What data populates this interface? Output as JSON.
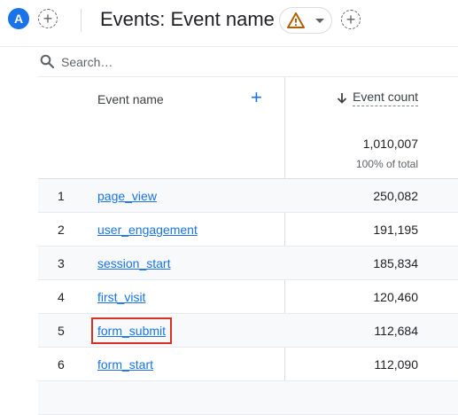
{
  "header": {
    "avatar_letter": "A",
    "title": "Events: Event name"
  },
  "search": {
    "placeholder": "Search…"
  },
  "table": {
    "col_name_header": "Event name",
    "col_count_header": "Event count",
    "total_count": "1,010,007",
    "total_pct": "100% of total",
    "rows": [
      {
        "index": "1",
        "name": "page_view",
        "count": "250,082"
      },
      {
        "index": "2",
        "name": "user_engagement",
        "count": "191,195"
      },
      {
        "index": "3",
        "name": "session_start",
        "count": "185,834"
      },
      {
        "index": "4",
        "name": "first_visit",
        "count": "120,460"
      },
      {
        "index": "5",
        "name": "form_submit",
        "count": "112,684"
      },
      {
        "index": "6",
        "name": "form_start",
        "count": "112,090"
      }
    ]
  },
  "colors": {
    "accent": "#1a73e8",
    "warning": "#b06000",
    "highlight": "#d93025"
  }
}
